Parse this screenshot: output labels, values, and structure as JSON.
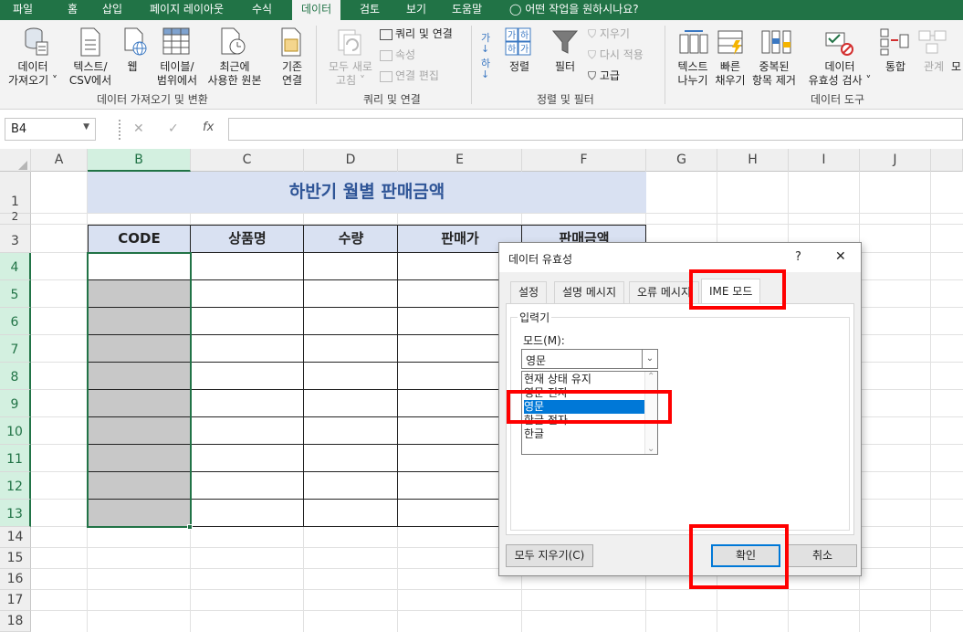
{
  "menu": {
    "tabs": [
      "파일",
      "홈",
      "삽입",
      "페이지 레이아웃",
      "수식",
      "데이터",
      "검토",
      "보기",
      "도움말"
    ],
    "active_index": 5,
    "tell_me": "어떤 작업을 원하시나요?"
  },
  "ribbon": {
    "get_data": {
      "btn_get_data": [
        "데이터",
        "가져오기 ˅"
      ],
      "btn_text_csv": [
        "텍스트/",
        "CSV에서"
      ],
      "btn_web": [
        "웹"
      ],
      "btn_table_range": [
        "테이블/",
        "범위에서"
      ],
      "btn_recent": [
        "최근에",
        "사용한 원본"
      ],
      "btn_existing": [
        "기존",
        "연결"
      ],
      "group_label": "데이터 가져오기 및 변환"
    },
    "queries": {
      "btn_refresh_all": [
        "모두 새로",
        "고침 ˅"
      ],
      "btn_queries_connections": "쿼리 및 연결",
      "btn_properties": "속성",
      "btn_edit_links": "연결 편집",
      "group_label": "쿼리 및 연결"
    },
    "sort_filter": {
      "btn_sort": "정렬",
      "btn_filter": "필터",
      "btn_clear": "지우기",
      "btn_reapply": "다시 적용",
      "btn_advanced": "고급",
      "group_label": "정렬 및 필터"
    },
    "data_tools": {
      "btn_text_to_columns": [
        "텍스트",
        "나누기"
      ],
      "btn_flash_fill": [
        "빠른",
        "채우기"
      ],
      "btn_remove_dup": [
        "중복된",
        "항목 제거"
      ],
      "btn_validation": [
        "데이터",
        "유효성 검사 ˅"
      ],
      "btn_consolidate": [
        "통합"
      ],
      "btn_relationships": [
        "관계"
      ],
      "btn_more": [
        "모"
      ],
      "group_label": "데이터 도구"
    }
  },
  "formula_bar": {
    "name_box": "B4",
    "fx": "fx",
    "formula": ""
  },
  "sheet": {
    "columns": [
      "A",
      "B",
      "C",
      "D",
      "E",
      "F",
      "G",
      "H",
      "I",
      "J"
    ],
    "rows": [
      "1",
      "2",
      "3",
      "4",
      "5",
      "6",
      "7",
      "8",
      "9",
      "10",
      "11",
      "12",
      "13",
      "14",
      "15",
      "16",
      "17",
      "18"
    ],
    "title": "하반기 월별 판매금액",
    "headers": [
      "CODE",
      "상품명",
      "수량",
      "판매가",
      "판매금액"
    ]
  },
  "dialog": {
    "title": "데이터 유효성",
    "help": "?",
    "close": "✕",
    "tabs": [
      "설정",
      "설명 메시지",
      "오류 메시지",
      "IME 모드"
    ],
    "active_tab": 3,
    "group_label": "입력기",
    "mode_label": "모드(M):",
    "mode_value": "영문",
    "options": [
      "현재 상태 유지",
      "영문 전자",
      "영문",
      "한글 전자",
      "한글"
    ],
    "selected_option": 2,
    "btn_clear_all": "모두 지우기(C)",
    "btn_ok": "확인",
    "btn_cancel": "취소"
  },
  "colors": {
    "excel_green": "#217346",
    "header_fill": "#d9e1f2",
    "title_text": "#2f5597",
    "selected_cells": "#c8c8c8",
    "highlight": "#ff0000",
    "list_select": "#0078d7"
  }
}
